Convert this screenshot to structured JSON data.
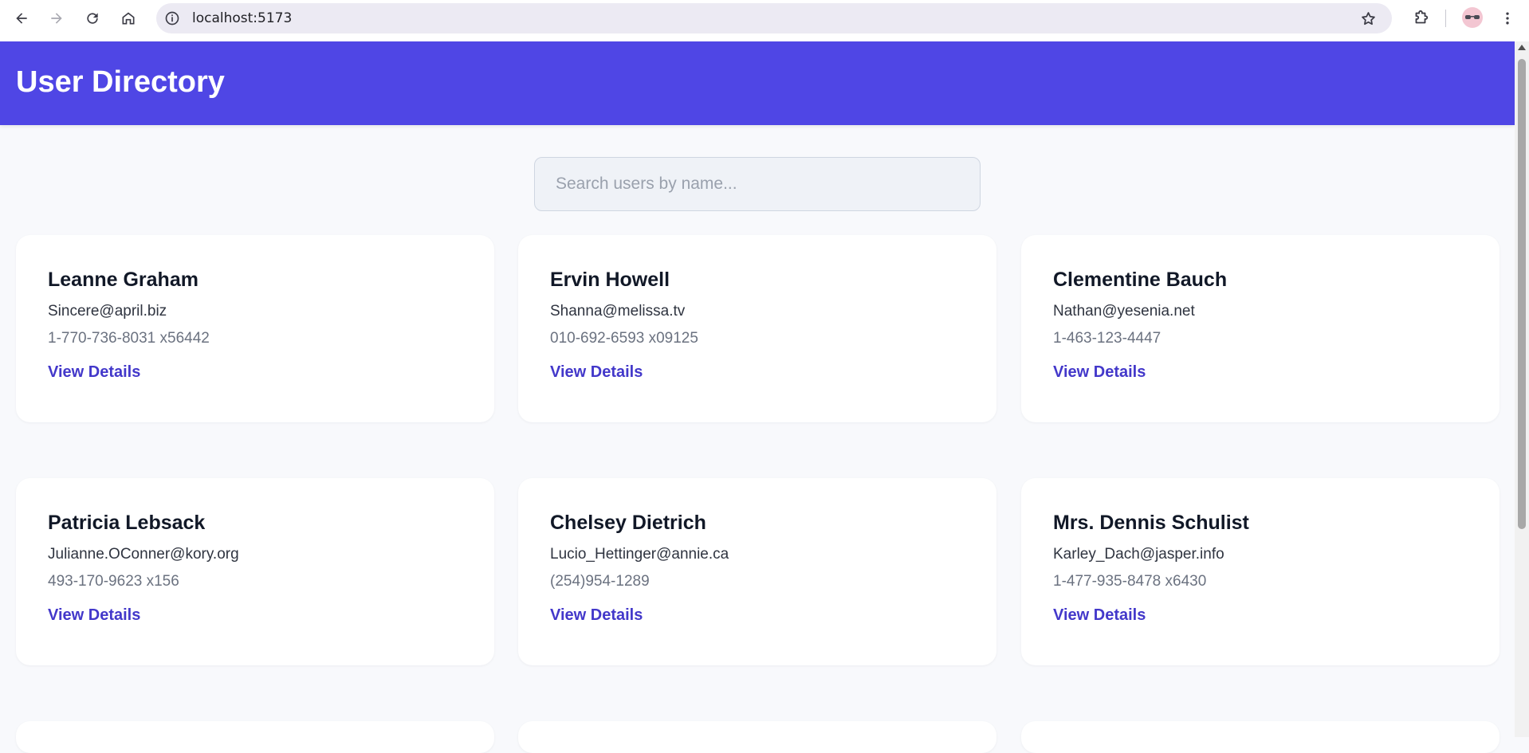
{
  "browser": {
    "url": "localhost:5173"
  },
  "app": {
    "title": "User Directory",
    "accent_color": "#4f46e5",
    "link_color": "#4338ca"
  },
  "search": {
    "placeholder": "Search users by name...",
    "value": ""
  },
  "users": [
    {
      "name": "Leanne Graham",
      "email": "Sincere@april.biz",
      "phone": "1-770-736-8031 x56442",
      "link": "View Details"
    },
    {
      "name": "Ervin Howell",
      "email": "Shanna@melissa.tv",
      "phone": "010-692-6593 x09125",
      "link": "View Details"
    },
    {
      "name": "Clementine Bauch",
      "email": "Nathan@yesenia.net",
      "phone": "1-463-123-4447",
      "link": "View Details"
    },
    {
      "name": "Patricia Lebsack",
      "email": "Julianne.OConner@kory.org",
      "phone": "493-170-9623 x156",
      "link": "View Details"
    },
    {
      "name": "Chelsey Dietrich",
      "email": "Lucio_Hettinger@annie.ca",
      "phone": "(254)954-1289",
      "link": "View Details"
    },
    {
      "name": "Mrs. Dennis Schulist",
      "email": "Karley_Dach@jasper.info",
      "phone": "1-477-935-8478 x6430",
      "link": "View Details"
    }
  ]
}
